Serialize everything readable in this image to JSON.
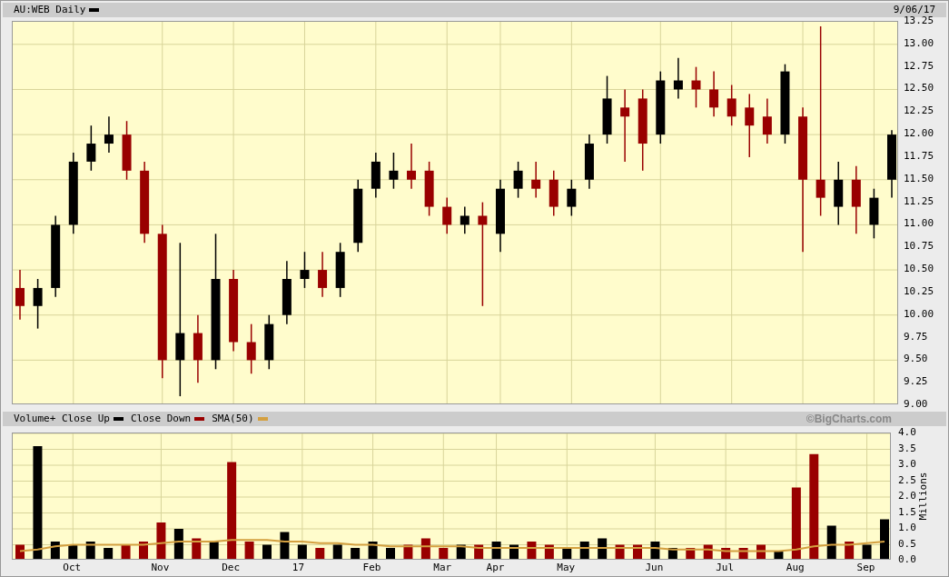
{
  "header": {
    "title": "AU:WEB Daily",
    "date": "9/06/17"
  },
  "price_chart": {
    "chart_data": {
      "type": "candlestick",
      "grid": true,
      "ylim": [
        9.0,
        13.25
      ],
      "categories": [
        null,
        null,
        null,
        null,
        null,
        null,
        null,
        null,
        null,
        null,
        null,
        null,
        null,
        null,
        null,
        null,
        null,
        null,
        null,
        null,
        null,
        null,
        null,
        null,
        null,
        null,
        null,
        null,
        null,
        null,
        null,
        null,
        null,
        null,
        null,
        null,
        null,
        null,
        null,
        null,
        null,
        null,
        null,
        null,
        null,
        null,
        null,
        null,
        null,
        null
      ],
      "yticks": [
        {
          "value": 9.0,
          "label": "9.00"
        },
        {
          "value": 9.25,
          "label": "9.25"
        },
        {
          "value": 9.5,
          "label": "9.50"
        },
        {
          "value": 9.75,
          "label": "9.75"
        },
        {
          "value": 10.0,
          "label": "10.00"
        },
        {
          "value": 10.25,
          "label": "10.25"
        },
        {
          "value": 10.5,
          "label": "10.50"
        },
        {
          "value": 10.75,
          "label": "10.75"
        },
        {
          "value": 11.0,
          "label": "11.00"
        },
        {
          "value": 11.25,
          "label": "11.25"
        },
        {
          "value": 11.5,
          "label": "11.50"
        },
        {
          "value": 11.75,
          "label": "11.75"
        },
        {
          "value": 12.0,
          "label": "12.00"
        },
        {
          "value": 12.25,
          "label": "12.25"
        },
        {
          "value": 12.5,
          "label": "12.50"
        },
        {
          "value": 12.75,
          "label": "12.75"
        },
        {
          "value": 13.0,
          "label": "13.00"
        },
        {
          "value": 13.25,
          "label": "13.25"
        }
      ],
      "ohlc": [
        [
          10.3,
          10.5,
          9.95,
          10.1
        ],
        [
          10.1,
          10.4,
          9.85,
          10.3
        ],
        [
          10.3,
          11.1,
          10.2,
          11.0
        ],
        [
          11.0,
          11.8,
          10.9,
          11.7
        ],
        [
          11.7,
          12.1,
          11.6,
          11.9
        ],
        [
          11.9,
          12.2,
          11.8,
          12.0
        ],
        [
          12.0,
          12.15,
          11.5,
          11.6
        ],
        [
          11.6,
          11.7,
          10.8,
          10.9
        ],
        [
          10.9,
          11.0,
          9.3,
          9.5
        ],
        [
          9.5,
          10.8,
          9.1,
          9.8
        ],
        [
          9.8,
          10.0,
          9.25,
          9.5
        ],
        [
          9.5,
          10.9,
          9.4,
          10.4
        ],
        [
          10.4,
          10.5,
          9.6,
          9.7
        ],
        [
          9.7,
          9.9,
          9.35,
          9.5
        ],
        [
          9.5,
          10.0,
          9.4,
          9.9
        ],
        [
          10.0,
          10.6,
          9.9,
          10.4
        ],
        [
          10.4,
          10.7,
          10.3,
          10.5
        ],
        [
          10.5,
          10.7,
          10.2,
          10.3
        ],
        [
          10.3,
          10.8,
          10.2,
          10.7
        ],
        [
          10.8,
          11.5,
          10.7,
          11.4
        ],
        [
          11.4,
          11.8,
          11.3,
          11.7
        ],
        [
          11.5,
          11.8,
          11.4,
          11.6
        ],
        [
          11.6,
          11.9,
          11.4,
          11.5
        ],
        [
          11.6,
          11.7,
          11.1,
          11.2
        ],
        [
          11.2,
          11.3,
          10.9,
          11.0
        ],
        [
          11.0,
          11.2,
          10.9,
          11.1
        ],
        [
          11.1,
          11.25,
          10.1,
          11.0
        ],
        [
          10.9,
          11.5,
          10.7,
          11.4
        ],
        [
          11.4,
          11.7,
          11.3,
          11.6
        ],
        [
          11.5,
          11.7,
          11.3,
          11.4
        ],
        [
          11.5,
          11.6,
          11.1,
          11.2
        ],
        [
          11.2,
          11.5,
          11.1,
          11.4
        ],
        [
          11.5,
          12.0,
          11.4,
          11.9
        ],
        [
          12.0,
          12.65,
          11.9,
          12.4
        ],
        [
          12.3,
          12.5,
          11.7,
          12.2
        ],
        [
          12.4,
          12.5,
          11.6,
          11.9
        ],
        [
          12.0,
          12.7,
          11.9,
          12.6
        ],
        [
          12.5,
          12.85,
          12.4,
          12.6
        ],
        [
          12.6,
          12.75,
          12.3,
          12.5
        ],
        [
          12.5,
          12.7,
          12.2,
          12.3
        ],
        [
          12.4,
          12.55,
          12.1,
          12.2
        ],
        [
          12.3,
          12.45,
          11.75,
          12.1
        ],
        [
          12.2,
          12.4,
          11.9,
          12.0
        ],
        [
          12.0,
          12.78,
          11.9,
          12.7
        ],
        [
          12.2,
          12.3,
          10.7,
          11.5
        ],
        [
          11.5,
          13.2,
          11.1,
          11.3
        ],
        [
          11.2,
          11.7,
          11.0,
          11.5
        ],
        [
          11.5,
          11.65,
          10.9,
          11.2
        ],
        [
          11.0,
          11.4,
          10.85,
          11.3
        ],
        [
          11.5,
          12.05,
          11.3,
          12.0
        ]
      ]
    }
  },
  "volume_legend": {
    "items": [
      {
        "label": "Volume+ Close Up",
        "color": "#000000"
      },
      {
        "label": "Close Down",
        "color": "#990000"
      },
      {
        "label": "SMA(50)",
        "color": "#d4a040"
      }
    ],
    "credit": "©BigCharts.com"
  },
  "volume_chart": {
    "chart_data": {
      "type": "bar",
      "grid": true,
      "ylabel": "Millions",
      "ylim": [
        0,
        4.0
      ],
      "categories": [
        null,
        null,
        null,
        "Oct",
        null,
        null,
        null,
        null,
        "Nov",
        null,
        null,
        null,
        "Dec",
        null,
        null,
        null,
        "17",
        null,
        null,
        null,
        "Feb",
        null,
        null,
        null,
        "Mar",
        null,
        null,
        "Apr",
        null,
        null,
        null,
        "May",
        null,
        null,
        null,
        null,
        "Jun",
        null,
        null,
        null,
        "Jul",
        null,
        null,
        null,
        "Aug",
        null,
        null,
        null,
        "Sep",
        null
      ],
      "yticks": [
        {
          "value": 0,
          "label": "0.0"
        },
        {
          "value": 0.5,
          "label": "0.5"
        },
        {
          "value": 1.0,
          "label": "1.0"
        },
        {
          "value": 1.5,
          "label": "1.5"
        },
        {
          "value": 2.0,
          "label": "2.0"
        },
        {
          "value": 2.5,
          "label": "2.5"
        },
        {
          "value": 3.0,
          "label": "3.0"
        },
        {
          "value": 3.5,
          "label": "3.5"
        },
        {
          "value": 4.0,
          "label": "4.0"
        }
      ],
      "series": [
        {
          "type": "bar",
          "colors": [
            "#990000",
            "#000000",
            "#000000",
            "#000000",
            "#000000",
            "#000000",
            "#990000",
            "#990000",
            "#990000",
            "#000000",
            "#990000",
            "#000000",
            "#990000",
            "#990000",
            "#000000",
            "#000000",
            "#000000",
            "#990000",
            "#000000",
            "#000000",
            "#000000",
            "#000000",
            "#990000",
            "#990000",
            "#990000",
            "#000000",
            "#990000",
            "#000000",
            "#000000",
            "#990000",
            "#990000",
            "#000000",
            "#000000",
            "#000000",
            "#990000",
            "#990000",
            "#000000",
            "#000000",
            "#990000",
            "#990000",
            "#990000",
            "#990000",
            "#990000",
            "#000000",
            "#990000",
            "#990000",
            "#000000",
            "#990000",
            "#000000",
            "#000000"
          ],
          "values": [
            0.5,
            3.6,
            0.6,
            0.5,
            0.6,
            0.4,
            0.5,
            0.6,
            1.2,
            1.0,
            0.7,
            0.6,
            3.1,
            0.6,
            0.5,
            0.9,
            0.5,
            0.4,
            0.5,
            0.4,
            0.6,
            0.4,
            0.5,
            0.7,
            0.4,
            0.5,
            0.5,
            0.6,
            0.5,
            0.6,
            0.5,
            0.4,
            0.6,
            0.7,
            0.5,
            0.5,
            0.6,
            0.4,
            0.4,
            0.5,
            0.4,
            0.4,
            0.5,
            0.3,
            2.3,
            3.35,
            1.1,
            0.6,
            0.5,
            1.3
          ]
        },
        {
          "type": "line",
          "color": "#d4a040",
          "values": [
            0.3,
            0.35,
            0.45,
            0.5,
            0.5,
            0.5,
            0.5,
            0.5,
            0.55,
            0.6,
            0.6,
            0.6,
            0.65,
            0.65,
            0.65,
            0.6,
            0.6,
            0.55,
            0.55,
            0.5,
            0.5,
            0.45,
            0.45,
            0.45,
            0.45,
            0.45,
            0.4,
            0.4,
            0.4,
            0.4,
            0.4,
            0.4,
            0.4,
            0.4,
            0.4,
            0.4,
            0.4,
            0.35,
            0.35,
            0.35,
            0.3,
            0.3,
            0.3,
            0.3,
            0.35,
            0.45,
            0.5,
            0.5,
            0.55,
            0.6
          ]
        }
      ]
    }
  }
}
